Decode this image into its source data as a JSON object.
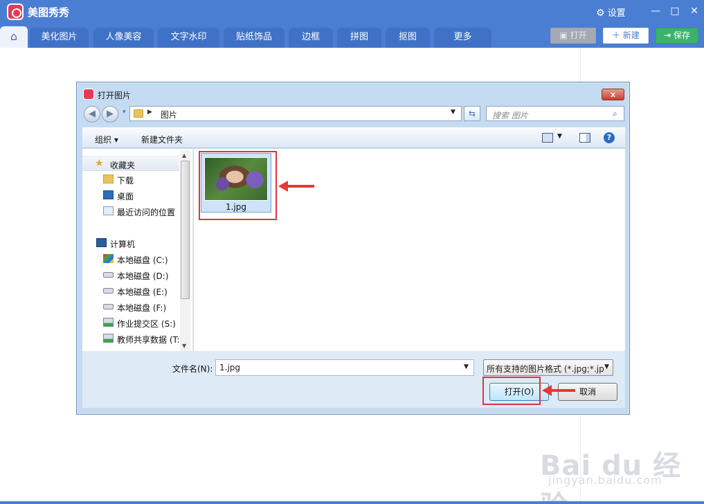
{
  "app": {
    "name": "美图秀秀",
    "settings_label": "设置",
    "window_controls": [
      "minimize-icon",
      "maximize-icon",
      "close-icon"
    ]
  },
  "tabs": [
    "美化图片",
    "人像美容",
    "文字水印",
    "贴纸饰品",
    "边框",
    "拼图",
    "抠图",
    "更多"
  ],
  "toolbar": {
    "open_label": "打开",
    "new_label": "新建",
    "save_label": "保存"
  },
  "dialog": {
    "title": "打开图片",
    "close_label": "x",
    "address": {
      "path": "图片"
    },
    "search_placeholder": "搜索 图片",
    "organize_label": "组织 ▾",
    "new_folder_label": "新建文件夹",
    "nav": {
      "favorites_label": "收藏夹",
      "favorites": [
        "下载",
        "桌面",
        "最近访问的位置"
      ],
      "computer_label": "计算机",
      "drives": [
        "本地磁盘 (C:)",
        "本地磁盘 (D:)",
        "本地磁盘 (E:)",
        "本地磁盘 (F:)",
        "作业提交区 (S:)",
        "教师共享数据 (T:"
      ]
    },
    "files": [
      {
        "name": "1.jpg",
        "selected": true
      }
    ],
    "filename_label": "文件名(N):",
    "filename_value": "1.jpg",
    "filter_value": "所有支持的图片格式 (*.jpg;*.jp",
    "open_button": "打开(O)",
    "cancel_button": "取消"
  },
  "annotation_color": "#e53935",
  "watermark": {
    "line1": "Bai du 经验",
    "line2": "jingyan.baidu.com"
  }
}
